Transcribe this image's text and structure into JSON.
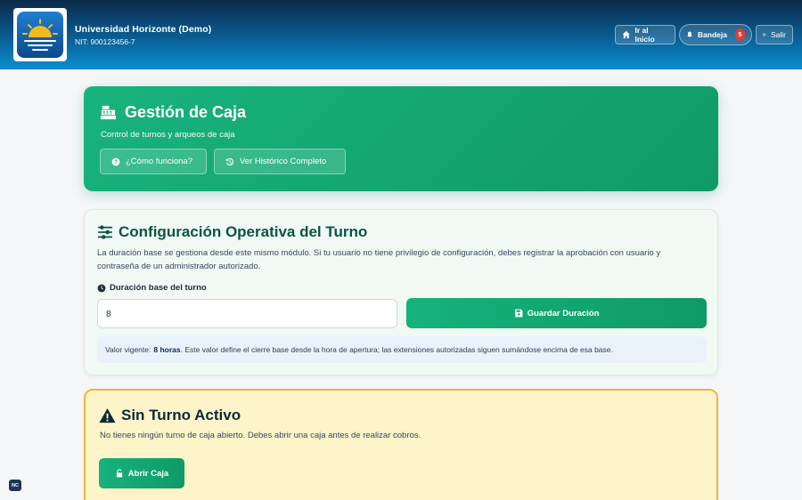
{
  "header": {
    "org_name": "Universidad Horizonte (Demo)",
    "org_nit": "NIT: 900123456-7",
    "home_label": "Ir al Inicio",
    "inbox_label": "Bandeja",
    "inbox_count": "5",
    "logout_label": "Salir"
  },
  "hero": {
    "title": "Gestión de Caja",
    "subtitle": "Control de turnos y arqueos de caja",
    "help_label": "¿Cómo funciona?",
    "history_label": "Ver Histórico Completo"
  },
  "config": {
    "title": "Configuración Operativa del Turno",
    "description": "La duración base se gestiona desde este mismo módulo. Si tu usuario no tiene privilegio de configuración, debes registrar la aprobación con usuario y contraseña de un administrador autorizado.",
    "field_label": "Duración base del turno",
    "field_value": "8",
    "save_label": "Guardar Duración",
    "info_prefix": "Valor vigente:",
    "info_value": "8 horas",
    "info_suffix": ". Este valor define el cierre base desde la hora de apertura; las extensiones autorizadas siguen sumándose encima de esa base."
  },
  "warning": {
    "title": "Sin Turno Activo",
    "description": "No tienes ningún turno de caja abierto. Debes abrir una caja antes de realizar cobros.",
    "open_label": "Abrir Caja"
  },
  "corner_badge": "NC",
  "colors": {
    "header_top": "#0b2a4a",
    "header_bottom": "#0a8ed0",
    "accent_green": "#16b27d",
    "warning_bg": "#fdf4c9",
    "warning_border": "#f2b43a",
    "badge_red": "#e23a3a"
  },
  "icons": {
    "home": "home-icon",
    "inbox": "bell-icon",
    "logout": "sign-out-icon",
    "hero": "cash-register-icon",
    "help": "question-circle-icon",
    "history": "history-icon",
    "config": "sliders-icon",
    "clock": "clock-icon",
    "save": "floppy-disk-icon",
    "warning": "warning-triangle-icon",
    "unlock": "unlock-icon"
  }
}
